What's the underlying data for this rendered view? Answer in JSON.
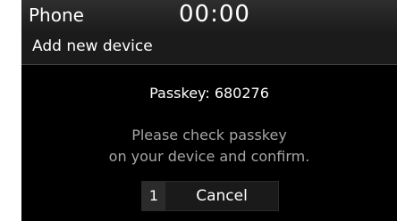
{
  "status_bar": {
    "app_title": "Phone",
    "clock": "00:00"
  },
  "popup": {
    "title": "Add new device",
    "passkey_text": "Passkey: 680276",
    "message_lines": [
      "Please check passkey",
      "on your device and confirm."
    ],
    "cancel_button": {
      "number": "1",
      "label": "Cancel"
    }
  }
}
